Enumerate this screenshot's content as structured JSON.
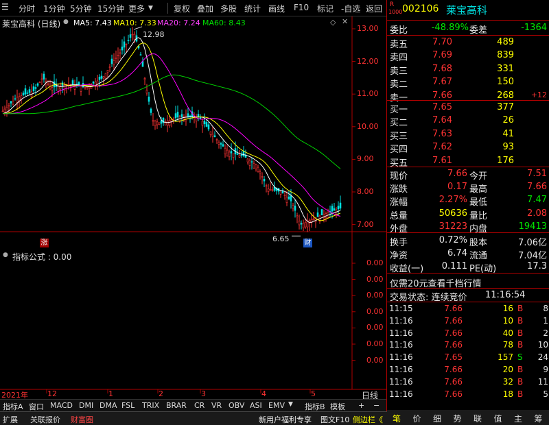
{
  "toolbar": {
    "items": [
      "分时",
      "1分钟",
      "5分钟",
      "15分钟",
      "更多",
      "复权",
      "叠加",
      "多股",
      "统计",
      "画线",
      "F10",
      "标记",
      "-自选",
      "返回"
    ]
  },
  "chart": {
    "title": "莱宝高科 (日线)",
    "ma5": "MA5: 7.43",
    "ma10": "MA10: 7.33",
    "ma20": "MA20: 7.24",
    "ma60": "MA60: 8.43",
    "high_label": "12.98",
    "low_label": "6.65",
    "up_tag": "涨",
    "fin_tag": "财",
    "y_ticks": [
      "13.00",
      "12.00",
      "11.00",
      "10.00",
      "9.00",
      "8.00",
      "7.00"
    ],
    "x_labels": [
      "2021年",
      "12",
      "1",
      "2",
      "3",
      "4",
      "5"
    ],
    "indicator_title": "指标公式 : 0.00",
    "ind_ticks": [
      "0.00",
      "0.00",
      "0.00",
      "0.00",
      "0.00",
      "0.00",
      "0.00"
    ],
    "day_label": "日线"
  },
  "chart_data": {
    "type": "candlestick",
    "title": "莱宝高科 (日线)",
    "high": 12.98,
    "low": 6.65,
    "ylim": [
      6.5,
      13.2
    ],
    "ma": [
      {
        "name": "MA5",
        "value": 7.43,
        "color": "#ffffff"
      },
      {
        "name": "MA10",
        "value": 7.33,
        "color": "#ffff00"
      },
      {
        "name": "MA20",
        "value": 7.24,
        "color": "#ff00ff"
      },
      {
        "name": "MA60",
        "value": 8.43,
        "color": "#00d000"
      }
    ],
    "x_labels": [
      "2021年",
      "12",
      "1",
      "2",
      "3",
      "4",
      "5"
    ]
  },
  "tabs": {
    "left": [
      "指标A",
      "窗口",
      "MACD",
      "DMI",
      "DMA",
      "FSL",
      "TRIX",
      "BRAR",
      "CR",
      "VR",
      "OBV",
      "ASI",
      "EMV"
    ],
    "right": [
      "指标B",
      "模板",
      "+",
      "−"
    ]
  },
  "status": {
    "left": [
      "扩展",
      "关联报价",
      "财富圈"
    ],
    "promo": "新用户福利专享",
    "f10": "图文F10",
    "sidebar": "侧边栏《"
  },
  "quote": {
    "code": "002106",
    "name": "莱宝高科",
    "badge_top": "R",
    "badge_bot": "1000",
    "weibi_label": "委比",
    "weibi": "-48.89%",
    "weicha_label": "委差",
    "weicha": "-1364",
    "asks": [
      {
        "label": "卖五",
        "price": "7.70",
        "vol": "489",
        "chg": ""
      },
      {
        "label": "卖四",
        "price": "7.69",
        "vol": "839",
        "chg": ""
      },
      {
        "label": "卖三",
        "price": "7.68",
        "vol": "331",
        "chg": ""
      },
      {
        "label": "卖二",
        "price": "7.67",
        "vol": "150",
        "chg": ""
      },
      {
        "label": "卖一",
        "price": "7.66",
        "vol": "268",
        "chg": "+12"
      }
    ],
    "bids": [
      {
        "label": "买一",
        "price": "7.65",
        "vol": "377"
      },
      {
        "label": "买二",
        "price": "7.64",
        "vol": "26"
      },
      {
        "label": "买三",
        "price": "7.63",
        "vol": "41"
      },
      {
        "label": "买四",
        "price": "7.62",
        "vol": "93"
      },
      {
        "label": "买五",
        "price": "7.61",
        "vol": "176"
      }
    ],
    "stats": [
      [
        "现价",
        "7.66",
        "今开",
        "7.51"
      ],
      [
        "涨跌",
        "0.17",
        "最高",
        "7.66"
      ],
      [
        "涨幅",
        "2.27%",
        "最低",
        "7.47"
      ],
      [
        "总量",
        "50636",
        "量比",
        "2.08"
      ],
      [
        "外盘",
        "31223",
        "内盘",
        "19413"
      ]
    ],
    "stats2": [
      [
        "换手",
        "0.72%",
        "股本",
        "7.06亿"
      ],
      [
        "净资",
        "6.74",
        "流通",
        "7.04亿"
      ],
      [
        "收益(一)",
        "0.111",
        "PE(动)",
        "17.3"
      ]
    ],
    "promo": "仅需20元查看千档行情",
    "trade_status": "交易状态: 连续竞价",
    "trade_time": "11:16:54",
    "ticks": [
      [
        "11:15",
        "7.66",
        "16",
        "B",
        "8"
      ],
      [
        "11:16",
        "7.66",
        "10",
        "B",
        "1"
      ],
      [
        "11:16",
        "7.66",
        "40",
        "B",
        "2"
      ],
      [
        "11:16",
        "7.66",
        "78",
        "B",
        "10"
      ],
      [
        "11:16",
        "7.65",
        "157",
        "S",
        "24"
      ],
      [
        "11:16",
        "7.66",
        "20",
        "B",
        "9"
      ],
      [
        "11:16",
        "7.66",
        "32",
        "B",
        "11"
      ],
      [
        "11:16",
        "7.66",
        "18",
        "B",
        "5"
      ]
    ],
    "bottom_tabs": [
      "笔",
      "价",
      "细",
      "势",
      "联",
      "值",
      "主",
      "筹"
    ]
  }
}
